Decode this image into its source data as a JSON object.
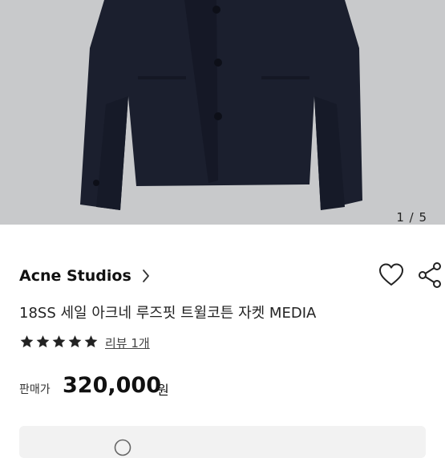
{
  "gallery": {
    "image_alt": "navy jacket",
    "counter": "1 / 5"
  },
  "brand": {
    "name": "Acne Studios",
    "chevron_icon": "chevron-right-icon"
  },
  "actions": {
    "like_icon": "heart-icon",
    "share_icon": "share-icon"
  },
  "product": {
    "title": "18SS 세일 아크네 루즈핏 트윌코튼 자켓 MEDIA",
    "rating": {
      "stars": 5,
      "review_link": "리뷰 1개"
    },
    "price_label": "판매가",
    "price": "320,000",
    "currency": "원"
  },
  "colors": {
    "jacket": "#1b1f2e",
    "background": "#c8c9cb",
    "star": "#222222"
  }
}
